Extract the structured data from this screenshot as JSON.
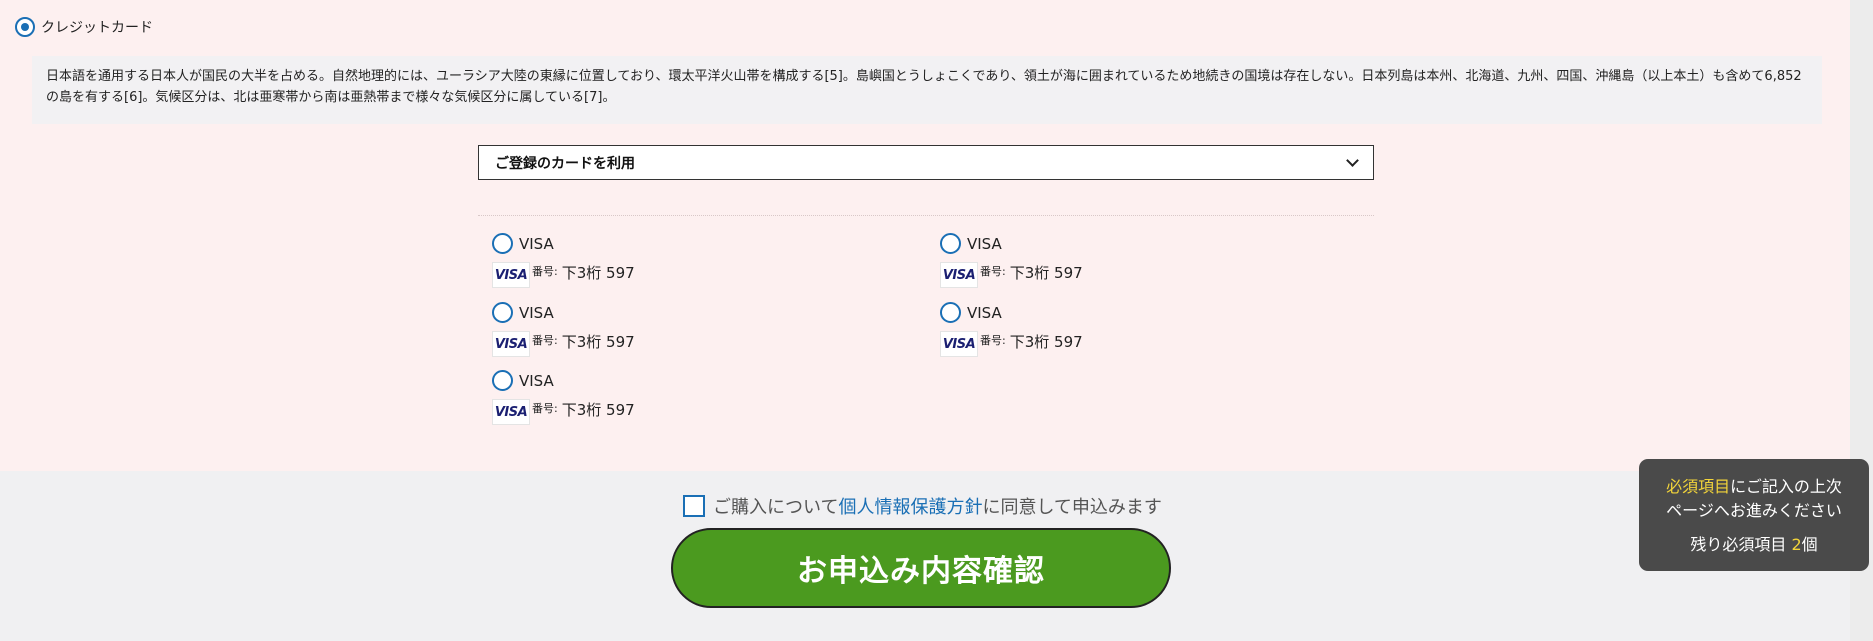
{
  "payment_method": {
    "label": "クレジットカード"
  },
  "notice": {
    "text": "日本語を通用する日本人が国民の大半を占める。自然地理的には、ユーラシア大陸の東縁に位置しており、環太平洋火山帯を構成する[5]。島嶼国とうしょこくであり、領土が海に囲まれているため地続きの国境は存在しない。日本列島は本州、北海道、九州、四国、沖縄島（以上本土）も含めて6,852の島を有する[6]。気候区分は、北は亜寒帯から南は亜熱帯まで様々な気候区分に属している[7]。"
  },
  "card_select": {
    "value": "ご登録のカードを利用"
  },
  "cards": [
    {
      "brand": "VISA",
      "logo": "VISA",
      "number_label": "番号:",
      "number_value": "下3桁 597"
    },
    {
      "brand": "VISA",
      "logo": "VISA",
      "number_label": "番号:",
      "number_value": "下3桁 597"
    },
    {
      "brand": "VISA",
      "logo": "VISA",
      "number_label": "番号:",
      "number_value": "下3桁 597"
    },
    {
      "brand": "VISA",
      "logo": "VISA",
      "number_label": "番号:",
      "number_value": "下3桁 597"
    },
    {
      "brand": "VISA",
      "logo": "VISA",
      "number_label": "番号:",
      "number_value": "下3桁 597"
    }
  ],
  "consent": {
    "prefix": "ご購入について",
    "link": "個人情報保護方針",
    "suffix": "に同意して申込みます"
  },
  "submit": {
    "label": "お申込み内容確認"
  },
  "tooltip": {
    "highlight": "必須項目",
    "line1_rest": "にご記入の上次",
    "line2": "ページへお進みください",
    "remaining_prefix": "残り必須項目 ",
    "remaining_count": "2",
    "remaining_suffix": "個"
  },
  "colors": {
    "accent": "#1a6fb5",
    "submit_bg": "#4b9a1f",
    "tooltip_bg": "#4a4a4a",
    "highlight": "#f2d43a",
    "pink_bg": "#fdf0f0"
  }
}
